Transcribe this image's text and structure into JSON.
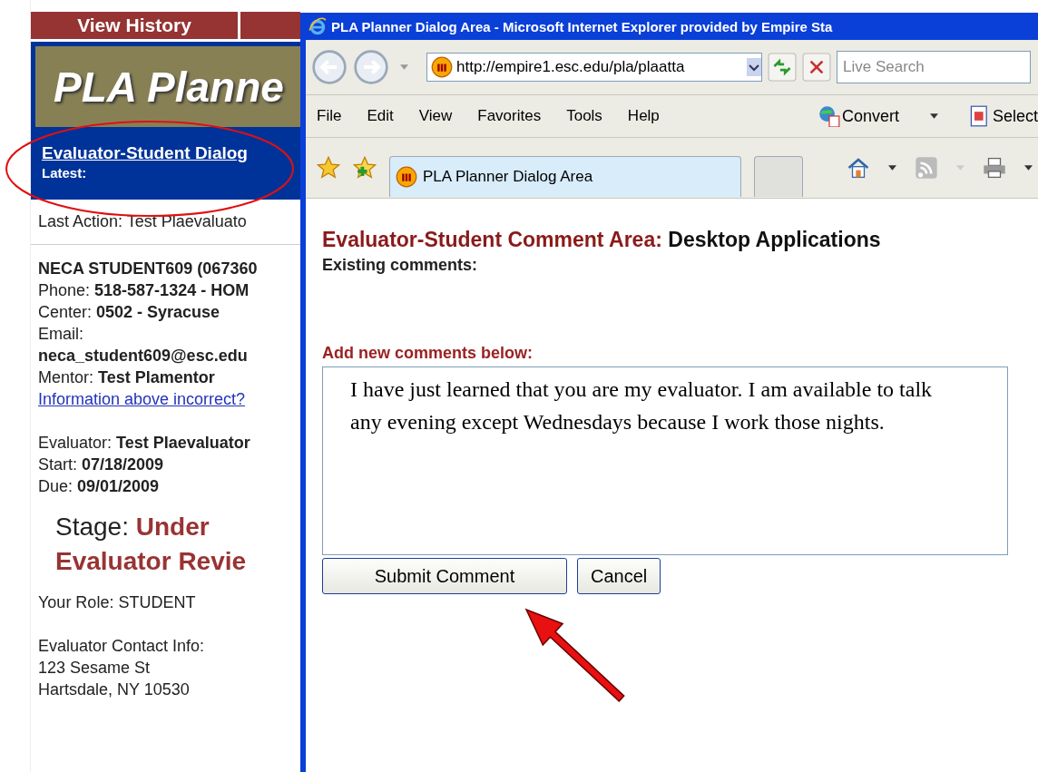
{
  "page": {
    "nav": {
      "tab": "View History"
    },
    "logo": "PLA Planne",
    "dialog": {
      "link": "Evaluator-Student Dialog",
      "latest": "Latest:"
    },
    "last_action": "Last Action: Test Plaevaluato",
    "student_name": "NECA STUDENT609 (067360",
    "student_info": [
      {
        "kind": "inline",
        "label": "Phone:",
        "value": "518-587-1324 - HOM"
      },
      {
        "kind": "inline",
        "label": "Center:",
        "value": "0502 - Syracuse"
      },
      {
        "kind": "stacked",
        "label": "Email:",
        "value": "neca_student609@esc.edu"
      },
      {
        "kind": "inline",
        "label": "Mentor:",
        "value": "Test Plamentor"
      }
    ],
    "info_link": "Information above incorrect?",
    "dates": [
      {
        "kind": "inline",
        "label": "Evaluator:",
        "value": "Test Plaevaluator"
      },
      {
        "kind": "inline",
        "label": "Start:",
        "value": "07/18/2009"
      },
      {
        "kind": "inline",
        "label": "Due:",
        "value": "09/01/2009"
      }
    ],
    "stage": {
      "label": "Stage:",
      "value": "Under Evaluator Revie"
    },
    "role": "Your Role: STUDENT",
    "contact": [
      "Evaluator Contact Info:",
      "123 Sesame St",
      "Hartsdale, NY 10530"
    ]
  },
  "browser": {
    "title": "PLA Planner Dialog Area - Microsoft Internet Explorer provided by Empire Sta",
    "url": "http://empire1.esc.edu/pla/plaatta",
    "search": {
      "placeholder": "Live Search"
    },
    "menu": [
      "File",
      "Edit",
      "View",
      "Favorites",
      "Tools",
      "Help"
    ],
    "tools": [
      {
        "kind": "convert",
        "label": "Convert"
      },
      {
        "kind": "select",
        "label": "Select"
      }
    ],
    "tabs": [
      {
        "label": "PLA Planner Dialog Area",
        "selected": true
      },
      {
        "selected": false
      }
    ],
    "content": {
      "heading_label": "Evaluator-Student Comment Area:",
      "heading_value": "Desktop Applications",
      "existing": "Existing comments:",
      "add_label": "Add new comments below:",
      "comment": "I have just learned that you are my evaluator. I am available to talk any evening except Wednesdays because I work those nights.",
      "buttons": [
        "Submit Comment",
        "Cancel"
      ]
    }
  }
}
